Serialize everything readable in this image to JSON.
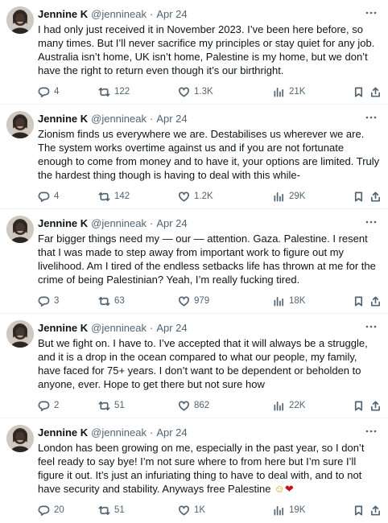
{
  "tweets": [
    {
      "name": "Jennine K",
      "handle": "@jennineak",
      "date": "Apr 24",
      "text": "I had only just received it in November 2023. I’ve been here before, so many times. But I’ll never sacrifice my principles or stay quiet for any job. Australia isn’t home, UK isn’t home, Palestine is my home, but we don’t have the right to return even though it’s our birthright.",
      "replies": "4",
      "reposts": "122",
      "likes": "1.3K",
      "views": "21K"
    },
    {
      "name": "Jennine K",
      "handle": "@jennineak",
      "date": "Apr 24",
      "text": "Zionism finds us everywhere we are. Destabilises us wherever we are. The system works overtime against us and if you are not fortunate enough to come from money and to have it, your options are limited. Truly the hardest thing though is having to deal with this while-",
      "replies": "4",
      "reposts": "142",
      "likes": "1.2K",
      "views": "29K"
    },
    {
      "name": "Jennine K",
      "handle": "@jennineak",
      "date": "Apr 24",
      "text": "Far bigger things need my — our — attention. Gaza. Palestine. I resent that I was made to step away from important work to figure out my livelihood. Am I tired of the endless setbacks life has thrown at me for the crime of being Palestinian? Yeah, I’m really fucking tired.",
      "replies": "3",
      "reposts": "63",
      "likes": "979",
      "views": "18K"
    },
    {
      "name": "Jennine K",
      "handle": "@jennineak",
      "date": "Apr 24",
      "text": "But we fight on. I have to. I’ve accepted that it will always be a struggle, and it is a drop in the ocean compared to what our people, my family, have faced for 75+ years. I don’t want to be dependent or beholden to anyone, ever. Hope to get there but not sure how",
      "replies": "2",
      "reposts": "51",
      "likes": "862",
      "views": "22K"
    },
    {
      "name": "Jennine K",
      "handle": "@jennineak",
      "date": "Apr 24",
      "text": "London has been growing on me, especially in the past year, so I don’t feel ready to say bye! I’m not sure where to from here but I’m sure I’ll figure it out. It’s just an infuriating thing to have to deal with, and to not have security and stability. Anyways free Palestine",
      "emoji": "☺",
      "emoji_heart": "❤",
      "replies": "20",
      "reposts": "51",
      "likes": "1K",
      "views": "19K"
    }
  ],
  "icons": {
    "reply": "reply-icon",
    "repost": "repost-icon",
    "like": "like-icon",
    "views": "views-icon",
    "bookmark": "bookmark-icon",
    "share": "share-icon",
    "more": "more-options-icon"
  },
  "colors": {
    "text": "#0f1419",
    "secondary": "#536471",
    "divider": "#eff3f4"
  }
}
